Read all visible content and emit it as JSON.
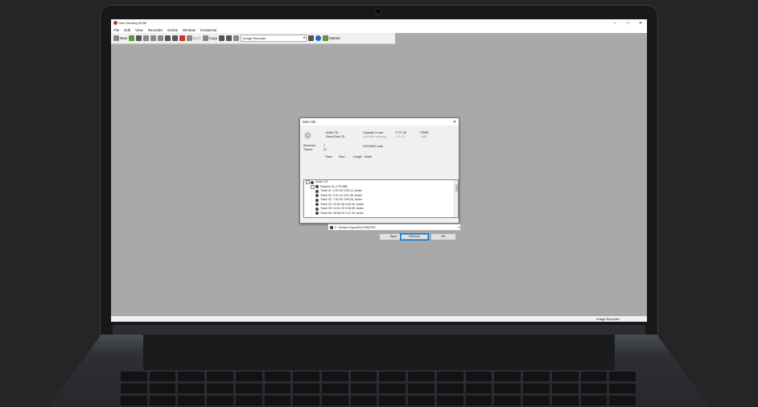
{
  "app": {
    "title": "Nero Burning ROM",
    "window_controls": [
      "–",
      "□",
      "✕"
    ]
  },
  "menu": [
    "File",
    "Edit",
    "View",
    "Recorder",
    "Extras",
    "Window",
    "KnowHow"
  ],
  "toolbar": {
    "new_label": "New",
    "burn_label": "Burn",
    "copy_label": "Copy",
    "recorder_select": "Image Recorder",
    "market_label": "Market"
  },
  "status": {
    "recorder": "Image Recorder"
  },
  "dialog": {
    "title": "Disc Info",
    "close": "✕",
    "disc_type": "Audio CD",
    "disc_state": "Read-Only CD",
    "capacity_label": "Capacity in use:",
    "capacity_time": "77:07.06",
    "capacity_size": "778MB",
    "available_label": "Available capacity:",
    "available_time": "0:00.00",
    "available_size": "0MB",
    "sessions_label": "Sessions:",
    "sessions_value": "1",
    "tracks_label": "Tracks:",
    "tracks_value": "21",
    "upc_label": "UPC/EAN code:",
    "columns": [
      "Track",
      "Start",
      "Length",
      "Mode"
    ],
    "tree": [
      {
        "label": "Audio CD",
        "level": 0
      },
      {
        "label": "Session 01 (778 MB)",
        "level": 1
      },
      {
        "label": "Track 01: 0:02.00 3:39.12, Audio",
        "level": 2
      },
      {
        "label": "Track 02: 3:41.12 3:21.40, Audio",
        "level": 2
      },
      {
        "label": "Track 03: 7:02.52 2:59.26, Audio",
        "level": 2
      },
      {
        "label": "Track 04: 10:02.08 4:29.25, Audio",
        "level": 2
      },
      {
        "label": "Track 05: 14:31.33 3:36.65, Audio",
        "level": 2
      },
      {
        "label": "Track 06: 18:08.23 2:47.35, Audio",
        "level": 2
      }
    ],
    "drive": "F: Toshiba SuperMULTIPA3TR1",
    "buttons": {
      "eject": "Eject",
      "refresh": "Refresh",
      "ok": "OK"
    }
  }
}
